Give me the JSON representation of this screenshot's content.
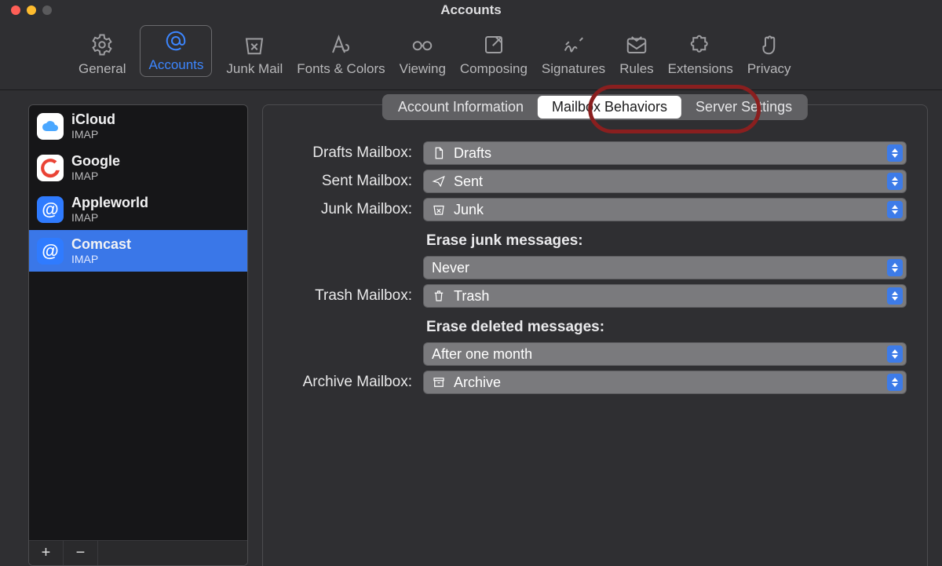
{
  "window": {
    "title": "Accounts"
  },
  "toolbar": {
    "items": [
      {
        "label": "General"
      },
      {
        "label": "Accounts"
      },
      {
        "label": "Junk Mail"
      },
      {
        "label": "Fonts & Colors"
      },
      {
        "label": "Viewing"
      },
      {
        "label": "Composing"
      },
      {
        "label": "Signatures"
      },
      {
        "label": "Rules"
      },
      {
        "label": "Extensions"
      },
      {
        "label": "Privacy"
      }
    ],
    "active_index": 1
  },
  "sidebar": {
    "accounts": [
      {
        "name": "iCloud",
        "subtitle": "IMAP",
        "icon": "icloud",
        "selected": false
      },
      {
        "name": "Google",
        "subtitle": "IMAP",
        "icon": "google",
        "selected": false
      },
      {
        "name": "Appleworld",
        "subtitle": "IMAP",
        "icon": "at",
        "selected": false
      },
      {
        "name": "Comcast",
        "subtitle": "IMAP",
        "icon": "at",
        "selected": true
      }
    ],
    "add_label": "+",
    "remove_label": "−"
  },
  "tabs": {
    "items": [
      "Account Information",
      "Mailbox Behaviors",
      "Server Settings"
    ],
    "active_index": 1
  },
  "form": {
    "drafts": {
      "label": "Drafts Mailbox:",
      "value": "Drafts"
    },
    "sent": {
      "label": "Sent Mailbox:",
      "value": "Sent"
    },
    "junk": {
      "label": "Junk Mailbox:",
      "value": "Junk"
    },
    "erase_junk": {
      "label": "Erase junk messages:",
      "value": "Never"
    },
    "trash": {
      "label": "Trash Mailbox:",
      "value": "Trash"
    },
    "erase_deleted": {
      "label": "Erase deleted messages:",
      "value": "After one month"
    },
    "archive": {
      "label": "Archive Mailbox:",
      "value": "Archive"
    }
  }
}
